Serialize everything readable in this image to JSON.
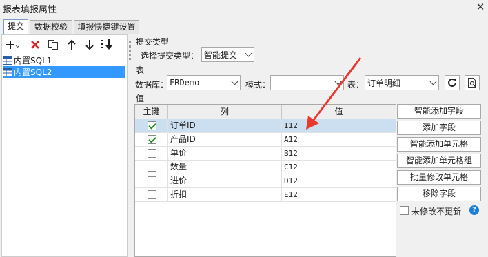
{
  "window": {
    "title": "报表填报属性"
  },
  "tabs": [
    {
      "label": "提交",
      "active": true
    },
    {
      "label": "数据校验",
      "active": false
    },
    {
      "label": "填报快捷键设置",
      "active": false
    }
  ],
  "left_toolbar": [
    "add-icon",
    "delete-icon",
    "copy-icon",
    "move-up-icon",
    "move-down-icon",
    "sort-icon"
  ],
  "tree": [
    {
      "label": "内置SQL1",
      "selected": false
    },
    {
      "label": "内置SQL2",
      "selected": true
    }
  ],
  "submit_type": {
    "section_label": "提交类型",
    "select_label": "选择提交类型：",
    "value": "智能提交"
  },
  "table_section": {
    "section_label": "表",
    "db_label": "数据库：",
    "db_value": "FRDemo",
    "mode_label": "模式：",
    "mode_value": "",
    "table_label": "表：",
    "table_value": "订单明细"
  },
  "value_section": {
    "section_label": "值",
    "columns": [
      "主键",
      "列",
      "值"
    ],
    "rows": [
      {
        "key": true,
        "column": "订单ID",
        "value": "I12",
        "selected": true
      },
      {
        "key": true,
        "column": "产品ID",
        "value": "A12",
        "selected": false
      },
      {
        "key": false,
        "column": "单价",
        "value": "B12",
        "selected": false
      },
      {
        "key": false,
        "column": "数量",
        "value": "C12",
        "selected": false
      },
      {
        "key": false,
        "column": "进价",
        "value": "D12",
        "selected": false
      },
      {
        "key": false,
        "column": "折扣",
        "value": "E12",
        "selected": false
      }
    ]
  },
  "right_buttons": [
    "智能添加字段",
    "添加字段",
    "智能添加单元格",
    "智能添加单元格组",
    "批量修改单元格",
    "移除字段"
  ],
  "no_update_unmodified": {
    "label": "未修改不更新",
    "checked": false
  },
  "colors": {
    "selection": "#3399ff",
    "row_selection": "#ccdff0",
    "arrow": "#e8392e",
    "help": "#1e7fd8"
  }
}
